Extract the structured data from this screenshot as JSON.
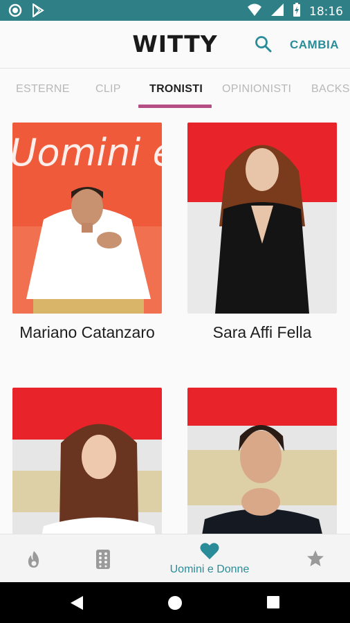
{
  "status_bar": {
    "time": "18:16"
  },
  "app_bar": {
    "title": "WITTY",
    "action_label": "CAMBIA"
  },
  "tabs": [
    {
      "label": "ESTERNE"
    },
    {
      "label": "CLIP"
    },
    {
      "label": "TRONISTI",
      "active": true
    },
    {
      "label": "OPINIONISTI"
    },
    {
      "label": "BACKSTAGE"
    }
  ],
  "photo_banner_text": "Uomini e Donne",
  "cards": [
    {
      "name": "Mariano Catanzaro"
    },
    {
      "name": "Sara Affi Fella"
    },
    {
      "name": ""
    },
    {
      "name": ""
    }
  ],
  "bottom_nav": {
    "active_label": "Uomini e Donne",
    "items": [
      {
        "icon": "flame-icon"
      },
      {
        "icon": "remote-icon"
      },
      {
        "icon": "heart-icon",
        "active": true
      },
      {
        "icon": "star-icon"
      }
    ]
  },
  "colors": {
    "status_bar": "#2f7f86",
    "accent": "#2a8c98",
    "tab_indicator": "#b44f86",
    "photo_red": "#e8242a"
  }
}
